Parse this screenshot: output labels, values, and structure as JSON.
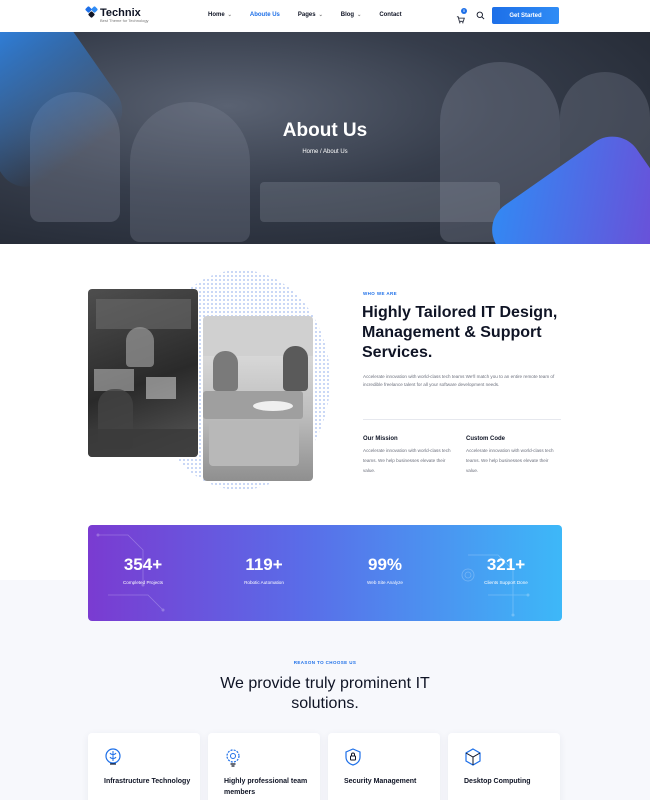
{
  "brand": {
    "name": "Technix",
    "tagline": "Best Theme for Technology"
  },
  "nav": {
    "items": [
      {
        "label": "Home",
        "dropdown": true
      },
      {
        "label": "Aboute Us",
        "dropdown": false
      },
      {
        "label": "Pages",
        "dropdown": true
      },
      {
        "label": "Blog",
        "dropdown": true
      },
      {
        "label": "Contact",
        "dropdown": false
      }
    ],
    "cart_count": "0",
    "cta_label": "Get Started"
  },
  "hero": {
    "title": "About Us",
    "breadcrumb": "Home / About Us"
  },
  "about": {
    "eyebrow": "WHO WE ARE",
    "title": "Highly Tailored IT Design, Management & Support Services.",
    "description": "Accelerate innovation with world-class tech teams We'll match you to an entire remote team of incredible freelance talent for all your software development needs.",
    "columns": [
      {
        "heading": "Our Mission",
        "text": "Accelerate innovation with world-class tech teams. We help businesses elevate their value."
      },
      {
        "heading": "Custom Code",
        "text": "Accelerate innovation with world-class tech teams. We help businesses elevate their value."
      }
    ]
  },
  "stats": [
    {
      "value": "354+",
      "label": "Completed Projects"
    },
    {
      "value": "119+",
      "label": "Robotic Automation"
    },
    {
      "value": "99%",
      "label": "Web Site Analyze"
    },
    {
      "value": "321+",
      "label": "Clients Support Done"
    }
  ],
  "reasons": {
    "eyebrow": "REASON TO CHOOSE US",
    "title": "We provide truly prominent IT solutions.",
    "cards": [
      {
        "title": "Infrastructure Technology",
        "icon": "brain-icon"
      },
      {
        "title": "Highly professional team members",
        "icon": "bulb-gear-icon"
      },
      {
        "title": "Security Management",
        "icon": "shield-lock-icon"
      },
      {
        "title": "Desktop Computing",
        "icon": "cube-icon"
      }
    ]
  },
  "colors": {
    "accent": "#1d6fe8",
    "gradient_start": "#7a3bd1",
    "gradient_end": "#3db8f8"
  }
}
